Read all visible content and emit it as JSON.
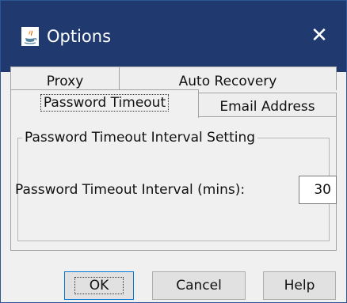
{
  "window": {
    "title": "Options",
    "close_glyph": "✕",
    "icon": "java-icon",
    "titlebar_color": "#203a6f",
    "border_color": "#2b5797"
  },
  "tabs": {
    "row1": [
      {
        "label": "Proxy"
      },
      {
        "label": "Auto Recovery"
      }
    ],
    "row2": [
      {
        "label": "Password Timeout",
        "selected": true
      },
      {
        "label": "Email Address"
      }
    ]
  },
  "panel": {
    "group_title": "Password Timeout Interval Setting",
    "interval_label": "Password Timeout Interval (mins):",
    "interval_value": "30"
  },
  "buttons": {
    "ok": "OK",
    "cancel": "Cancel",
    "help": "Help",
    "focus_color": "#0078d7"
  }
}
